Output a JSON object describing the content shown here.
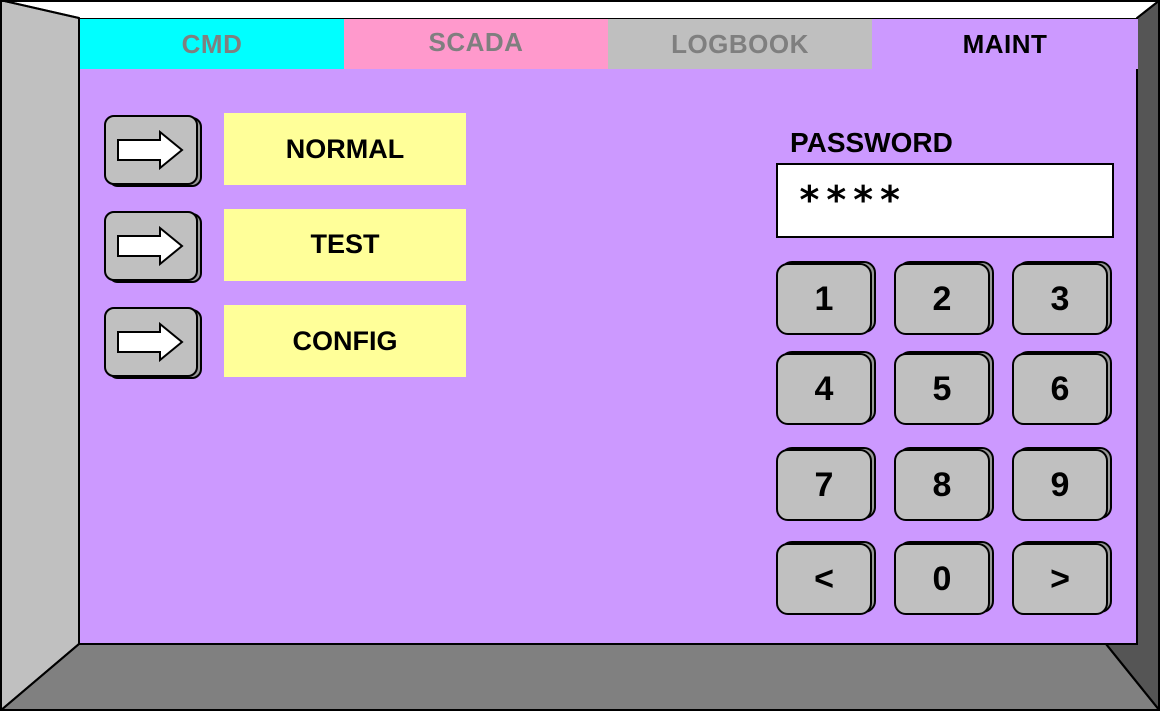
{
  "tabs": {
    "cmd": "CMD",
    "scada": "SCADA",
    "logbook": "LOGBOOK",
    "maint": "MAINT",
    "active": "MAINT"
  },
  "modes": [
    {
      "label": "NORMAL"
    },
    {
      "label": "TEST"
    },
    {
      "label": "CONFIG"
    }
  ],
  "password": {
    "title": "PASSWORD",
    "value": "****"
  },
  "keypad": {
    "keys": [
      "1",
      "2",
      "3",
      "4",
      "5",
      "6",
      "7",
      "8",
      "9",
      "<",
      "0",
      ">"
    ]
  },
  "colors": {
    "screen_bg": "#cc99ff",
    "tab_cmd": "#00ffff",
    "tab_scada": "#ff99cc",
    "tab_logbook": "#bfbfbf",
    "mode_label_bg": "#ffff99",
    "button_face": "#c0c0c0",
    "bezel_left": "#c0c0c0",
    "bezel_bottom": "#808080",
    "bezel_right": "#555555"
  },
  "icons": {
    "mode_button": "right-arrow-icon"
  }
}
